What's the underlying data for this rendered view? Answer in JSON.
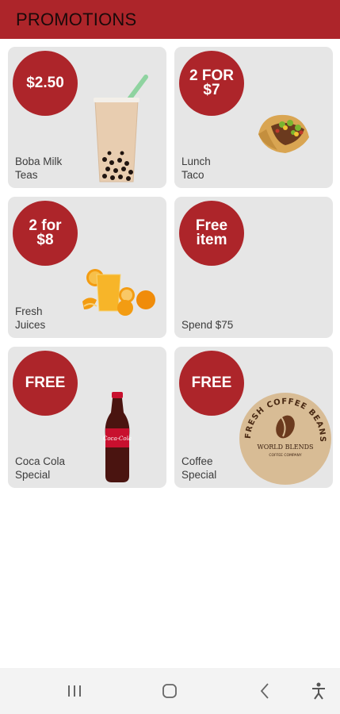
{
  "header": {
    "title": "PROMOTIONS"
  },
  "promotions": [
    {
      "badge": "$2.50",
      "label": "Boba Milk\nTeas",
      "image": "boba-tea-image"
    },
    {
      "badge": "2 FOR\n$7",
      "label": "Lunch\nTaco",
      "image": "taco-image"
    },
    {
      "badge": "2 for\n$8",
      "label": "Fresh\nJuices",
      "image": "orange-juice-image"
    },
    {
      "badge": "Free\nitem",
      "label": "Spend $75",
      "image": ""
    },
    {
      "badge": "FREE",
      "label": "Coca Cola\nSpecial",
      "image": "coca-cola-bottle-image"
    },
    {
      "badge": "FREE",
      "label": "Coffee\nSpecial",
      "image": "coffee-beans-logo-image"
    }
  ],
  "coffee_logo": {
    "ring_text": "FRESH COFFEE BEANS",
    "brand": "WORLD BLENDS",
    "sub": "COFFEE COMPANY"
  },
  "coke_label": "Coca-Cola",
  "navbar": {
    "icons": [
      "recent-apps-icon",
      "home-icon",
      "back-icon",
      "accessibility-icon"
    ]
  },
  "colors": {
    "accent": "#ad252a",
    "card": "#e6e6e6"
  }
}
